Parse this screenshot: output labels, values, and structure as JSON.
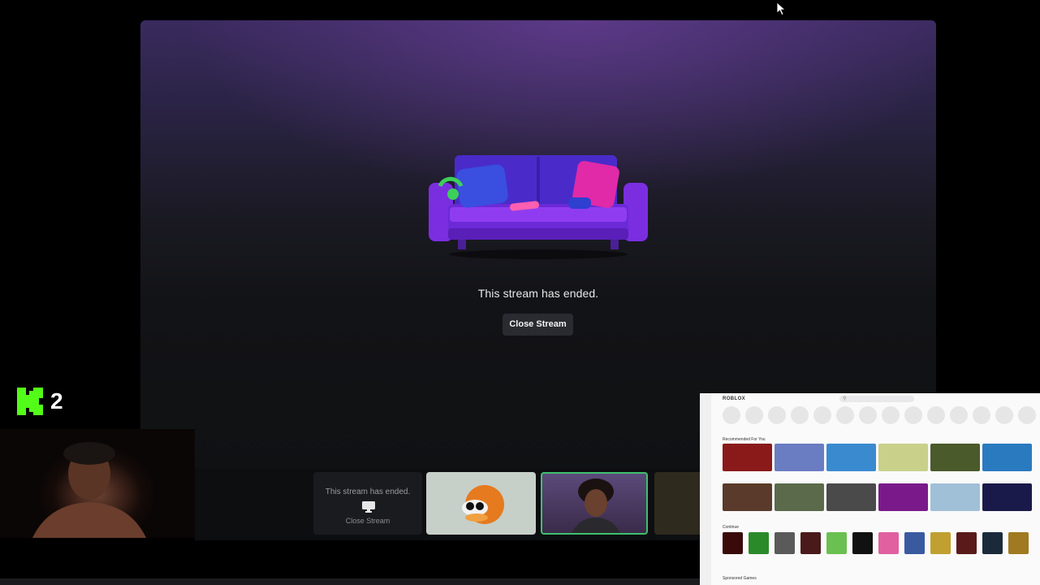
{
  "stream": {
    "ended_message": "This stream has ended.",
    "close_button": "Close Stream"
  },
  "overlay": {
    "kick_viewer_count": "2"
  },
  "thumbnails": {
    "ended_message": "This stream has ended.",
    "close_button": "Close Stream"
  },
  "roblox": {
    "brand": "ROBLOX",
    "search_placeholder": "Search",
    "section_recommended": "Recommended For You",
    "section_continue": "Continue",
    "section_sponsored": "Sponsored Games"
  },
  "colors": {
    "kick_green": "#53fc18",
    "active_thumb_border": "#3fbf6f",
    "couch_purple": "#7a2ee0"
  },
  "icons": [
    "kick-logo-icon",
    "couch-icon",
    "monitor-icon",
    "cursor-icon"
  ]
}
